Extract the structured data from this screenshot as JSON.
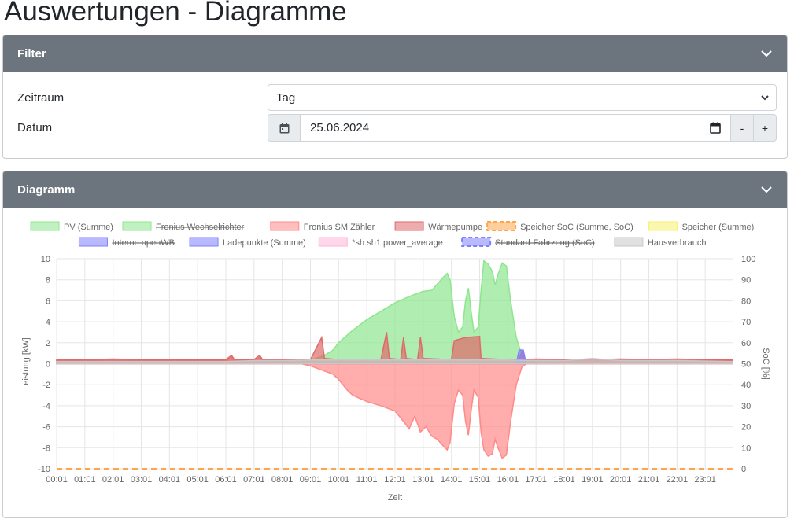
{
  "page": {
    "title": "Auswertungen - Diagramme"
  },
  "filter": {
    "header": "Filter",
    "period_label": "Zeitraum",
    "period_value": "Tag",
    "date_label": "Datum",
    "date_value": "25.06.2024",
    "minus_label": "-",
    "plus_label": "+"
  },
  "diagram": {
    "header": "Diagramm"
  },
  "colors": {
    "header_bg": "#6c757d",
    "pv": "#8ee68e",
    "grid": "#ff8a8a",
    "heatpump": "#e06a6a",
    "soc": "#ffa54d",
    "storage": "#f5f06e",
    "ev": "#8080ff",
    "power_avg": "#ffb6d9",
    "house": "#c8c8c8"
  },
  "chart_data": {
    "type": "area",
    "xlabel": "Zeit",
    "ylabel": "Leistung [kW]",
    "y2label": "SoC [%]",
    "ylim": [
      -10,
      10
    ],
    "y2lim": [
      0,
      100
    ],
    "grid": true,
    "legend_position": "top",
    "x_ticks": [
      "00:01",
      "01:01",
      "02:01",
      "03:01",
      "04:01",
      "05:01",
      "06:01",
      "07:01",
      "08:01",
      "09:01",
      "10:01",
      "11:01",
      "12:01",
      "13:01",
      "14:01",
      "15:01",
      "16:01",
      "17:01",
      "18:01",
      "19:01",
      "20:01",
      "21:01",
      "22:01",
      "23:01"
    ],
    "y_ticks": [
      "10",
      "8",
      "6",
      "4",
      "2",
      "0",
      "-2",
      "-4",
      "-6",
      "-8",
      "-10"
    ],
    "y2_ticks": [
      "100",
      "90",
      "80",
      "70",
      "60",
      "50",
      "40",
      "30",
      "20",
      "10",
      "0"
    ],
    "legend": [
      {
        "label": "PV (Summe)",
        "color": "#8ee68e",
        "hidden": false,
        "dashed": false
      },
      {
        "label": "Fronius Wechselrichter",
        "color": "#8ee68e",
        "hidden": true,
        "dashed": false
      },
      {
        "label": "Fronius SM Zähler",
        "color": "#ff8a8a",
        "hidden": false,
        "dashed": false
      },
      {
        "label": "Wärmepumpe",
        "color": "#e06a6a",
        "hidden": false,
        "dashed": false
      },
      {
        "label": "Speicher SoC (Summe, SoC)",
        "color": "#ffa54d",
        "hidden": false,
        "dashed": true
      },
      {
        "label": "Speicher (Summe)",
        "color": "#f5f06e",
        "hidden": false,
        "dashed": false
      },
      {
        "label": "Interne openWB",
        "color": "#8080ff",
        "hidden": true,
        "dashed": false
      },
      {
        "label": "Ladepunkte (Summe)",
        "color": "#8080ff",
        "hidden": false,
        "dashed": false
      },
      {
        "label": "*sh.sh1.power_average",
        "color": "#ffb6d9",
        "hidden": false,
        "dashed": false
      },
      {
        "label": "Standard-Fahrzeug (SoC)",
        "color": "#8080ff",
        "hidden": true,
        "dashed": true
      },
      {
        "label": "Hausverbrauch",
        "color": "#c8c8c8",
        "hidden": false,
        "dashed": false
      }
    ],
    "series": [
      {
        "name": "PV (Summe)",
        "color": "#8ee68e",
        "points": [
          [
            8.0,
            0
          ],
          [
            8.5,
            0.1
          ],
          [
            9.0,
            0.3
          ],
          [
            9.5,
            0.8
          ],
          [
            9.8,
            1.3
          ],
          [
            10.0,
            2.0
          ],
          [
            10.5,
            3.2
          ],
          [
            11.0,
            4.2
          ],
          [
            11.5,
            5.0
          ],
          [
            12.0,
            5.8
          ],
          [
            12.5,
            6.4
          ],
          [
            13.0,
            6.9
          ],
          [
            13.3,
            7.0
          ],
          [
            13.5,
            7.6
          ],
          [
            13.7,
            8.2
          ],
          [
            13.85,
            8.6
          ],
          [
            13.95,
            8.0
          ],
          [
            14.1,
            4.5
          ],
          [
            14.25,
            3.0
          ],
          [
            14.4,
            3.5
          ],
          [
            14.5,
            6.0
          ],
          [
            14.6,
            7.2
          ],
          [
            14.7,
            5.0
          ],
          [
            14.8,
            3.0
          ],
          [
            14.95,
            3.5
          ],
          [
            15.05,
            7.0
          ],
          [
            15.15,
            9.8
          ],
          [
            15.3,
            9.5
          ],
          [
            15.45,
            8.8
          ],
          [
            15.55,
            7.5
          ],
          [
            15.65,
            8.5
          ],
          [
            15.8,
            9.6
          ],
          [
            15.95,
            9.3
          ],
          [
            16.1,
            6.0
          ],
          [
            16.3,
            2.5
          ],
          [
            16.5,
            0.8
          ],
          [
            16.7,
            0.3
          ],
          [
            17.0,
            0.1
          ],
          [
            17.5,
            0
          ]
        ]
      },
      {
        "name": "Fronius SM Zähler",
        "color": "#ff8a8a",
        "points": [
          [
            0,
            0.3
          ],
          [
            1,
            0.3
          ],
          [
            2,
            0.35
          ],
          [
            3,
            0.3
          ],
          [
            4,
            0.3
          ],
          [
            5,
            0.3
          ],
          [
            6,
            0.3
          ],
          [
            6.2,
            0.6
          ],
          [
            6.3,
            0.3
          ],
          [
            7,
            0.3
          ],
          [
            7.2,
            0.6
          ],
          [
            7.3,
            0.3
          ],
          [
            8,
            0.2
          ],
          [
            8.5,
            0.1
          ],
          [
            9.0,
            -0.2
          ],
          [
            9.5,
            -0.7
          ],
          [
            9.8,
            -1.0
          ],
          [
            10.0,
            -1.5
          ],
          [
            10.3,
            -2.5
          ],
          [
            10.5,
            -3.0
          ],
          [
            11.0,
            -3.6
          ],
          [
            11.5,
            -4.0
          ],
          [
            12.0,
            -4.5
          ],
          [
            12.3,
            -5.5
          ],
          [
            12.5,
            -6.2
          ],
          [
            12.7,
            -5.0
          ],
          [
            12.9,
            -6.5
          ],
          [
            13.1,
            -6.0
          ],
          [
            13.3,
            -6.9
          ],
          [
            13.5,
            -7.2
          ],
          [
            13.7,
            -7.8
          ],
          [
            13.85,
            -8.2
          ],
          [
            13.95,
            -7.5
          ],
          [
            14.1,
            -3.8
          ],
          [
            14.25,
            -2.5
          ],
          [
            14.4,
            -3.0
          ],
          [
            14.5,
            -5.5
          ],
          [
            14.6,
            -6.8
          ],
          [
            14.7,
            -4.5
          ],
          [
            14.8,
            -2.5
          ],
          [
            14.95,
            -3.2
          ],
          [
            15.05,
            -6.5
          ],
          [
            15.15,
            -8.2
          ],
          [
            15.3,
            -8.8
          ],
          [
            15.45,
            -8.6
          ],
          [
            15.55,
            -7.2
          ],
          [
            15.65,
            -8.0
          ],
          [
            15.8,
            -9.0
          ],
          [
            15.95,
            -8.7
          ],
          [
            16.1,
            -5.5
          ],
          [
            16.3,
            -2.0
          ],
          [
            16.5,
            -0.3
          ],
          [
            16.7,
            0.1
          ],
          [
            17,
            0.3
          ],
          [
            18,
            0.35
          ],
          [
            19,
            0.3
          ],
          [
            20,
            0.3
          ],
          [
            21,
            0.35
          ],
          [
            22,
            0.3
          ],
          [
            23,
            0.3
          ],
          [
            23.97,
            0.3
          ]
        ]
      },
      {
        "name": "Wärmepumpe",
        "color": "#e06a6a",
        "points": [
          [
            0,
            0.4
          ],
          [
            1,
            0.4
          ],
          [
            2,
            0.45
          ],
          [
            3,
            0.4
          ],
          [
            4,
            0.4
          ],
          [
            5,
            0.4
          ],
          [
            6,
            0.4
          ],
          [
            6.2,
            0.8
          ],
          [
            6.3,
            0.4
          ],
          [
            7,
            0.4
          ],
          [
            7.2,
            0.8
          ],
          [
            7.3,
            0.4
          ],
          [
            8,
            0.35
          ],
          [
            9,
            0.4
          ],
          [
            9.4,
            2.5
          ],
          [
            9.5,
            0.5
          ],
          [
            10,
            0.4
          ],
          [
            11.5,
            0.4
          ],
          [
            11.7,
            3.0
          ],
          [
            11.8,
            0.5
          ],
          [
            12.2,
            0.4
          ],
          [
            12.3,
            2.5
          ],
          [
            12.4,
            0.5
          ],
          [
            12.8,
            0.4
          ],
          [
            12.9,
            2.5
          ],
          [
            13.0,
            0.5
          ],
          [
            14,
            0.4
          ],
          [
            14.1,
            2.2
          ],
          [
            14.5,
            2.5
          ],
          [
            15.0,
            2.6
          ],
          [
            15.05,
            0.5
          ],
          [
            16,
            0.4
          ],
          [
            16.4,
            0.4
          ],
          [
            16.5,
            1.2
          ],
          [
            16.6,
            0.4
          ],
          [
            17,
            0.45
          ],
          [
            18,
            0.4
          ],
          [
            19,
            0.4
          ],
          [
            20,
            0.45
          ],
          [
            21,
            0.4
          ],
          [
            22,
            0.45
          ],
          [
            23,
            0.4
          ],
          [
            23.97,
            0.4
          ]
        ]
      },
      {
        "name": "Speicher SoC (Summe, SoC)",
        "color": "#ffa54d",
        "axis": "y2",
        "points": [
          [
            0,
            0
          ],
          [
            23.97,
            0
          ]
        ]
      },
      {
        "name": "Ladepunkte (Summe)",
        "color": "#8080ff",
        "points": [
          [
            16.3,
            0
          ],
          [
            16.4,
            1.3
          ],
          [
            16.55,
            1.3
          ],
          [
            16.65,
            0
          ]
        ]
      },
      {
        "name": "Hausverbrauch",
        "color": "#c8c8c8",
        "points": [
          [
            0,
            0.2
          ],
          [
            6,
            0.2
          ],
          [
            7,
            0.3
          ],
          [
            8,
            0.3
          ],
          [
            9,
            0.35
          ],
          [
            10,
            0.35
          ],
          [
            12,
            0.35
          ],
          [
            14,
            0.35
          ],
          [
            16,
            0.35
          ],
          [
            17,
            0.3
          ],
          [
            18,
            0.3
          ],
          [
            19,
            0.5
          ],
          [
            20,
            0.3
          ],
          [
            22,
            0.3
          ],
          [
            23.97,
            0.2
          ]
        ]
      }
    ]
  }
}
